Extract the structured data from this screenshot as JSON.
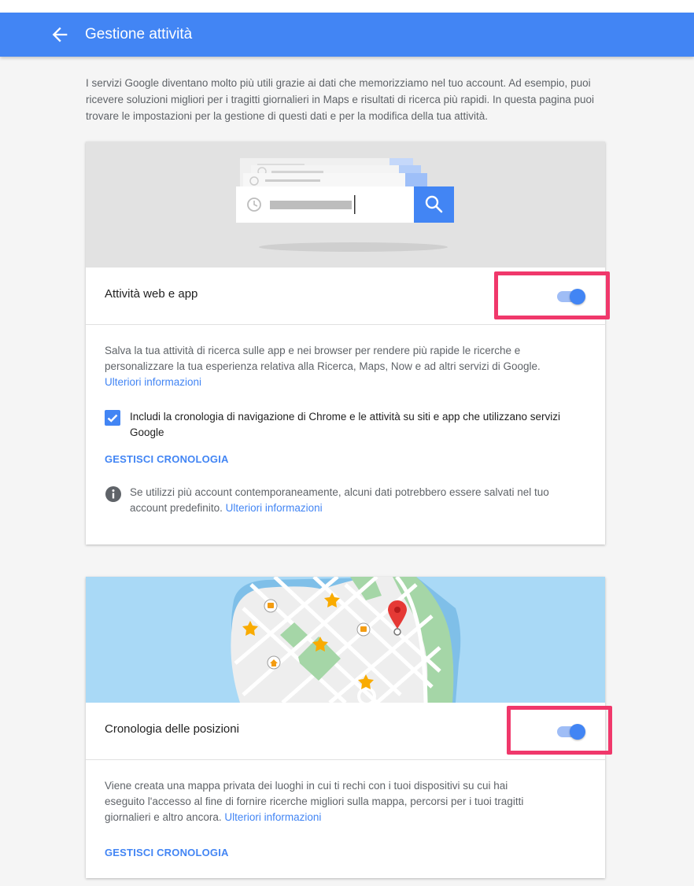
{
  "appbar": {
    "title": "Gestione attività",
    "back_icon": "arrow-back-icon",
    "color": "#4285f4"
  },
  "intro": {
    "text": "I servizi Google diventano molto più utili grazie ai dati che memorizziamo nel tuo account. Ad esempio, puoi ricevere soluzioni migliori per i tragitti giornalieri in Maps e risultati di ricerca più rapidi. In questa pagina puoi trovare le impostazioni per la gestione di questi dati e per la modifica della tua attività."
  },
  "web_app": {
    "title": "Attività web e app",
    "toggle_on": true,
    "description": "Salva la tua attività di ricerca sulle app e nei browser per rendere più rapide le ricerche e personalizzare la tua esperienza relativa alla Ricerca, Maps, Now e ad altri servizi di Google.",
    "more_info_link": "Ulteriori informazioni",
    "checkbox_checked": true,
    "checkbox_label": "Includi la cronologia di navigazione di Chrome e le attività su siti e app che utilizzano servizi Google",
    "manage_label": "GESTISCI CRONOLOGIA",
    "info_text": "Se utilizzi più account contemporaneamente, alcuni dati potrebbero essere salvati nel tuo account predefinito.",
    "info_link": "Ulteriori informazioni"
  },
  "location": {
    "title": "Cronologia delle posizioni",
    "toggle_on": true,
    "description": "Viene creata una mappa privata dei luoghi in cui ti rechi con i tuoi dispositivi su cui hai eseguito l'accesso al fine di fornire ricerche migliori sulla mappa, percorsi per i tuoi tragitti giornalieri e altro ancora.",
    "more_info_link": "Ulteriori informazioni",
    "manage_label": "GESTISCI CRONOLOGIA"
  },
  "colors": {
    "accent": "#4285f4",
    "highlight": "#f0386b"
  }
}
